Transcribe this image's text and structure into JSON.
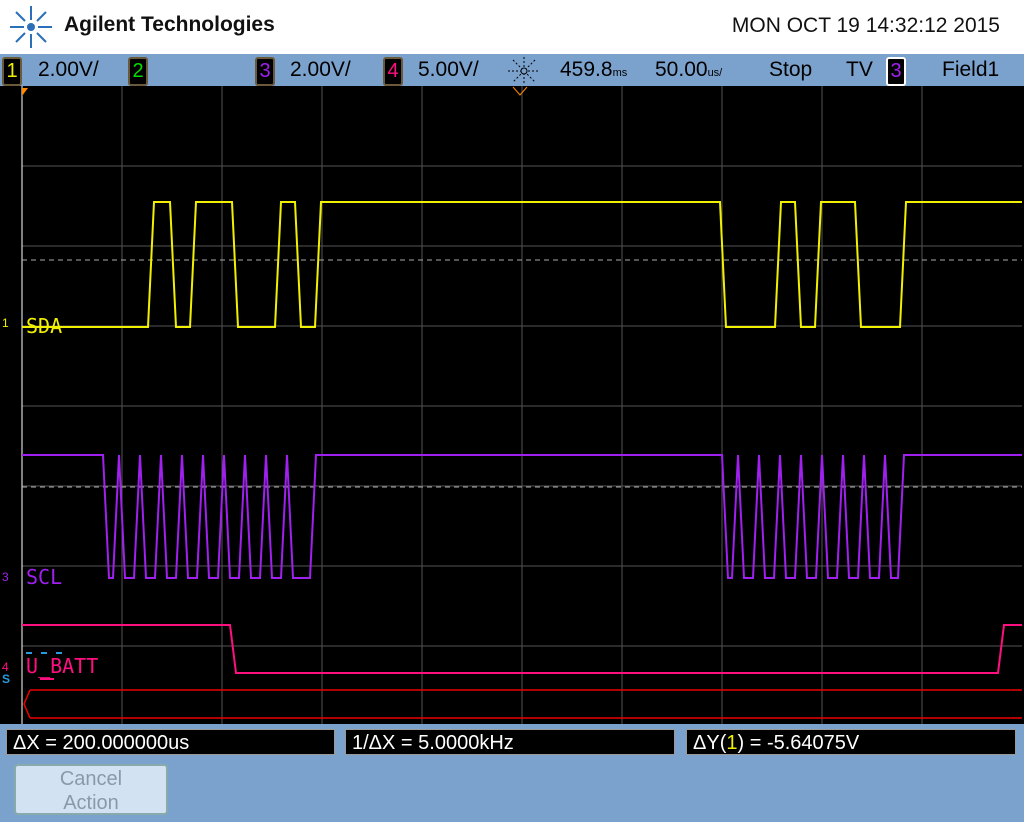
{
  "header": {
    "brand": "Agilent Technologies",
    "datetime": "MON OCT 19 14:32:12 2015"
  },
  "status": {
    "ch1": {
      "num": "1",
      "scale": "2.00V/",
      "color": "#f0f000"
    },
    "ch2": {
      "num": "2",
      "color": "#00e000"
    },
    "ch3": {
      "num": "3",
      "scale": "2.00V/",
      "color": "#a020f0"
    },
    "ch4": {
      "num": "4",
      "scale": "5.00V/",
      "color": "#ff1080"
    },
    "delay": "459.8",
    "delay_unit": "ms",
    "timebase": "50.00",
    "timebase_unit": "us/",
    "run_state": "Stop",
    "trigger_type": "TV",
    "trigger_source": "3",
    "trigger_mode": "Field1"
  },
  "traces": {
    "sda_label": "SDA",
    "scl_label": "SCL",
    "ubatt_label": "U_BATT",
    "ch1_marker": "1",
    "ch3_marker": "3",
    "ch4_marker": "4",
    "serial_marker": "S"
  },
  "measurements": {
    "dx": "ΔX = 200.000000us",
    "inv_dx": "1/ΔX = 5.0000kHz",
    "dy_prefix": "ΔY(",
    "dy_ch": "1",
    "dy_suffix": ") = -5.64075V"
  },
  "softkey": {
    "line1": "Cancel",
    "line2": "Action"
  }
}
